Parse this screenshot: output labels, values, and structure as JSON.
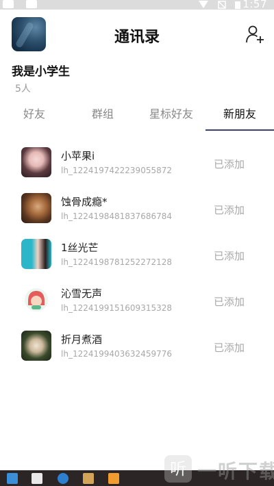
{
  "status_bar": {
    "time": "1:57"
  },
  "header": {
    "title": "通讯录",
    "add_user_icon": "add-user-icon"
  },
  "profile": {
    "name": "我是小学生",
    "count": "5人"
  },
  "tabs": [
    {
      "label": "好友",
      "active": false
    },
    {
      "label": "群组",
      "active": false
    },
    {
      "label": "星标好友",
      "active": false
    },
    {
      "label": "新朋友",
      "active": true
    }
  ],
  "friends": [
    {
      "name": "小苹果i",
      "id": "lh_1224197422239055872",
      "status": "已添加"
    },
    {
      "name": "蚀骨成瘾*",
      "id": "lh_1224198481837686784",
      "status": "已添加"
    },
    {
      "name": "1丝光芒",
      "id": "lh_1224198781252272128",
      "status": "已添加"
    },
    {
      "name": "沁雪无声",
      "id": "lh_1224199151609315328",
      "status": "已添加"
    },
    {
      "name": "折月煮酒",
      "id": "lh_1224199403632459776",
      "status": "已添加"
    }
  ],
  "watermark": {
    "logo_char": "听",
    "text": "一听下载"
  },
  "colors": {
    "accent": "#3b3f6e",
    "muted": "#a8a8a8",
    "taskbar": "#2b2525"
  }
}
